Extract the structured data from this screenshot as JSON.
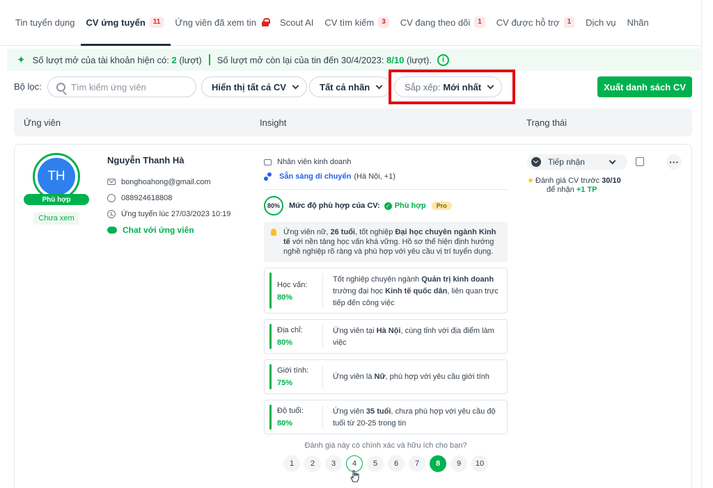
{
  "tabs": [
    {
      "label": "Tin tuyển dụng",
      "badge": ""
    },
    {
      "label": "CV ứng tuyển",
      "badge": "11"
    },
    {
      "label": "Ứng viên đã xem tin",
      "badge": ""
    },
    {
      "label": "Scout AI",
      "badge": ""
    },
    {
      "label": "CV tìm kiếm",
      "badge": "3"
    },
    {
      "label": "CV đang theo dõi",
      "badge": "1"
    },
    {
      "label": "CV được hỗ trợ",
      "badge": "1"
    },
    {
      "label": "Dịch vụ",
      "badge": ""
    },
    {
      "label": "Nhãn",
      "badge": ""
    }
  ],
  "notice": {
    "part1": "Số lượt mở của tài khoản hiện có:",
    "val1": "2",
    "unit1": "(lượt)",
    "part2": "Số lượt mở còn lại của tin đến 30/4/2023:",
    "val2": "8/10",
    "unit2": "(lượt)."
  },
  "filters": {
    "label": "Bộ lọc:",
    "search_placeholder": "Tìm kiếm ứng viên",
    "show_all": "Hiển thị tất cả CV",
    "all_tags": "Tất cả nhãn",
    "sort_label": "Sắp xếp:",
    "sort_value": "Mới nhất",
    "export": "Xuất danh sách CV"
  },
  "table_header": {
    "col1": "Ứng viên",
    "col2": "Insight",
    "col3": "Trạng thái"
  },
  "candidate": {
    "initials": "TH",
    "match_badge": "Phù hợp",
    "seen_status": "Chưa xem",
    "name": "Nguyễn Thanh Hà",
    "email": "bonghoahong@gmail.com",
    "phone": "088924618808",
    "applied": "Ứng tuyển lúc 27/03/2023 10:19",
    "chat": "Chat với ứng viên"
  },
  "insight": {
    "job": "Nhân viên kinh doanh",
    "move_label": "Sẵn sàng di chuyển",
    "move_detail": "(Hà Nội, +1)",
    "fit_percent": "80%",
    "fit_label": "Mức độ phù hợp của CV:",
    "fit_value": "Phù hợp",
    "pro": "Pro",
    "summary": {
      "t1": "Ứng viên nữ, ",
      "b1": "26 tuổi",
      "t2": ", tốt nghiệp ",
      "b2": "Đại học chuyên ngành Kinh tế",
      "t3": " với nền tảng học vấn khá vững. Hồ sơ thể hiện định hướng nghề nghiệp rõ ràng và phù hợp với yêu cầu vị trí tuyển dụng."
    },
    "criteria": [
      {
        "title": "Học vấn:",
        "percent": "80%",
        "t1": "Tốt nghiệp chuyên ngành ",
        "b1": "Quản trị kinh doanh",
        "t2": " trường đại học ",
        "b2": "Kinh tế quốc dân",
        "t3": ", liên quan trực tiếp đến công việc"
      },
      {
        "title": "Địa chỉ:",
        "percent": "80%",
        "t1": "Ứng viên tại ",
        "b1": "Hà Nội",
        "t2": ", cùng tỉnh với địa điểm làm việc",
        "b2": "",
        "t3": ""
      },
      {
        "title": "Giới tính:",
        "percent": "75%",
        "t1": "Ứng viên là ",
        "b1": "Nữ",
        "t2": ", phù hợp với yêu cầu giới tính",
        "b2": "",
        "t3": ""
      },
      {
        "title": "Độ tuổi:",
        "percent": "80%",
        "t1": "Ứng viên ",
        "b1": "35 tuổi",
        "t2": ", chưa phù hợp với yêu cầu độ tuổi từ 20-25 trong tin",
        "b2": "",
        "t3": ""
      }
    ],
    "question": "Đánh giá này có chính xác và hữu ích cho bạn?",
    "ratings": [
      "1",
      "2",
      "3",
      "4",
      "5",
      "6",
      "7",
      "8",
      "9",
      "10"
    ],
    "rating_selected": "8"
  },
  "status": {
    "value": "Tiếp nhận",
    "more": "···",
    "rate_text": "Đánh giá CV trước",
    "rate_val": "30/10",
    "rate_text2": "để nhận",
    "reward": "+1 TP"
  }
}
